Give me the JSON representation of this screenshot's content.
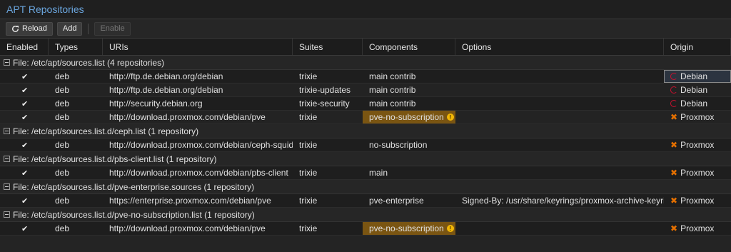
{
  "panel": {
    "title": "APT Repositories"
  },
  "toolbar": {
    "reload_label": "Reload",
    "add_label": "Add",
    "enable_label": "Enable"
  },
  "columns": {
    "enabled": "Enabled",
    "types": "Types",
    "uris": "URIs",
    "suites": "Suites",
    "components": "Components",
    "options": "Options",
    "origin": "Origin"
  },
  "groups": [
    {
      "label": "File: /etc/apt/sources.list (4 repositories)",
      "rows": [
        {
          "type": "deb",
          "uri": "http://ftp.de.debian.org/debian",
          "suite": "trixie",
          "components": "main contrib",
          "options": "",
          "origin": "Debian"
        },
        {
          "type": "deb",
          "uri": "http://ftp.de.debian.org/debian",
          "suite": "trixie-updates",
          "components": "main contrib",
          "options": "",
          "origin": "Debian"
        },
        {
          "type": "deb",
          "uri": "http://security.debian.org",
          "suite": "trixie-security",
          "components": "main contrib",
          "options": "",
          "origin": "Debian"
        },
        {
          "type": "deb",
          "uri": "http://download.proxmox.com/debian/pve",
          "suite": "trixie",
          "components": "pve-no-subscription",
          "options": "",
          "origin": "Proxmox"
        }
      ]
    },
    {
      "label": "File: /etc/apt/sources.list.d/ceph.list (1 repository)",
      "rows": [
        {
          "type": "deb",
          "uri": "http://download.proxmox.com/debian/ceph-squid",
          "suite": "trixie",
          "components": "no-subscription",
          "options": "",
          "origin": "Proxmox"
        }
      ]
    },
    {
      "label": "File: /etc/apt/sources.list.d/pbs-client.list (1 repository)",
      "rows": [
        {
          "type": "deb",
          "uri": "http://download.proxmox.com/debian/pbs-client",
          "suite": "trixie",
          "components": "main",
          "options": "",
          "origin": "Proxmox"
        }
      ]
    },
    {
      "label": "File: /etc/apt/sources.list.d/pve-enterprise.sources (1 repository)",
      "rows": [
        {
          "type": "deb",
          "uri": "https://enterprise.proxmox.com/debian/pve",
          "suite": "trixie",
          "components": "pve-enterprise",
          "options": "Signed-By: /usr/share/keyrings/proxmox-archive-keyring.gpg",
          "origin": "Proxmox"
        }
      ]
    },
    {
      "label": "File: /etc/apt/sources.list.d/pve-no-subscription.list (1 repository)",
      "rows": [
        {
          "type": "deb",
          "uri": "http://download.proxmox.com/debian/pve",
          "suite": "trixie",
          "components": "pve-no-subscription",
          "options": "",
          "origin": "Proxmox"
        }
      ]
    }
  ],
  "colors": {
    "title": "#6ba6de",
    "warning_bg": "#7a5512",
    "warning_icon": "#f2b705",
    "debian": "#c8102e",
    "proxmox": "#e57000"
  },
  "icons": {
    "reload": "refresh-icon",
    "check": "check-icon",
    "warning": "warning-icon",
    "debian": "debian-logo-icon",
    "proxmox": "proxmox-logo-icon"
  }
}
